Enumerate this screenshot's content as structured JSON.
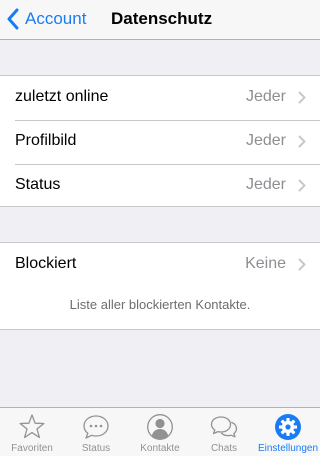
{
  "nav": {
    "back_label": "Account",
    "title": "Datenschutz"
  },
  "privacy_group": {
    "rows": [
      {
        "label": "zuletzt online",
        "value": "Jeder"
      },
      {
        "label": "Profilbild",
        "value": "Jeder"
      },
      {
        "label": "Status",
        "value": "Jeder"
      }
    ]
  },
  "blocked_group": {
    "label": "Blockiert",
    "value": "Keine",
    "note": "Liste aller blockierten Kontakte."
  },
  "tabbar": {
    "active": "Einstellungen",
    "tabs": [
      {
        "label": "Favoriten",
        "icon": "star-icon"
      },
      {
        "label": "Status",
        "icon": "speech-bubble-icon"
      },
      {
        "label": "Kontakte",
        "icon": "contact-icon"
      },
      {
        "label": "Chats",
        "icon": "chats-icon"
      },
      {
        "label": "Einstellungen",
        "icon": "gear-icon"
      }
    ]
  },
  "colors": {
    "accent": "#1a7cf5",
    "background": "#efeff4",
    "secondary_text": "#8e8e93"
  }
}
